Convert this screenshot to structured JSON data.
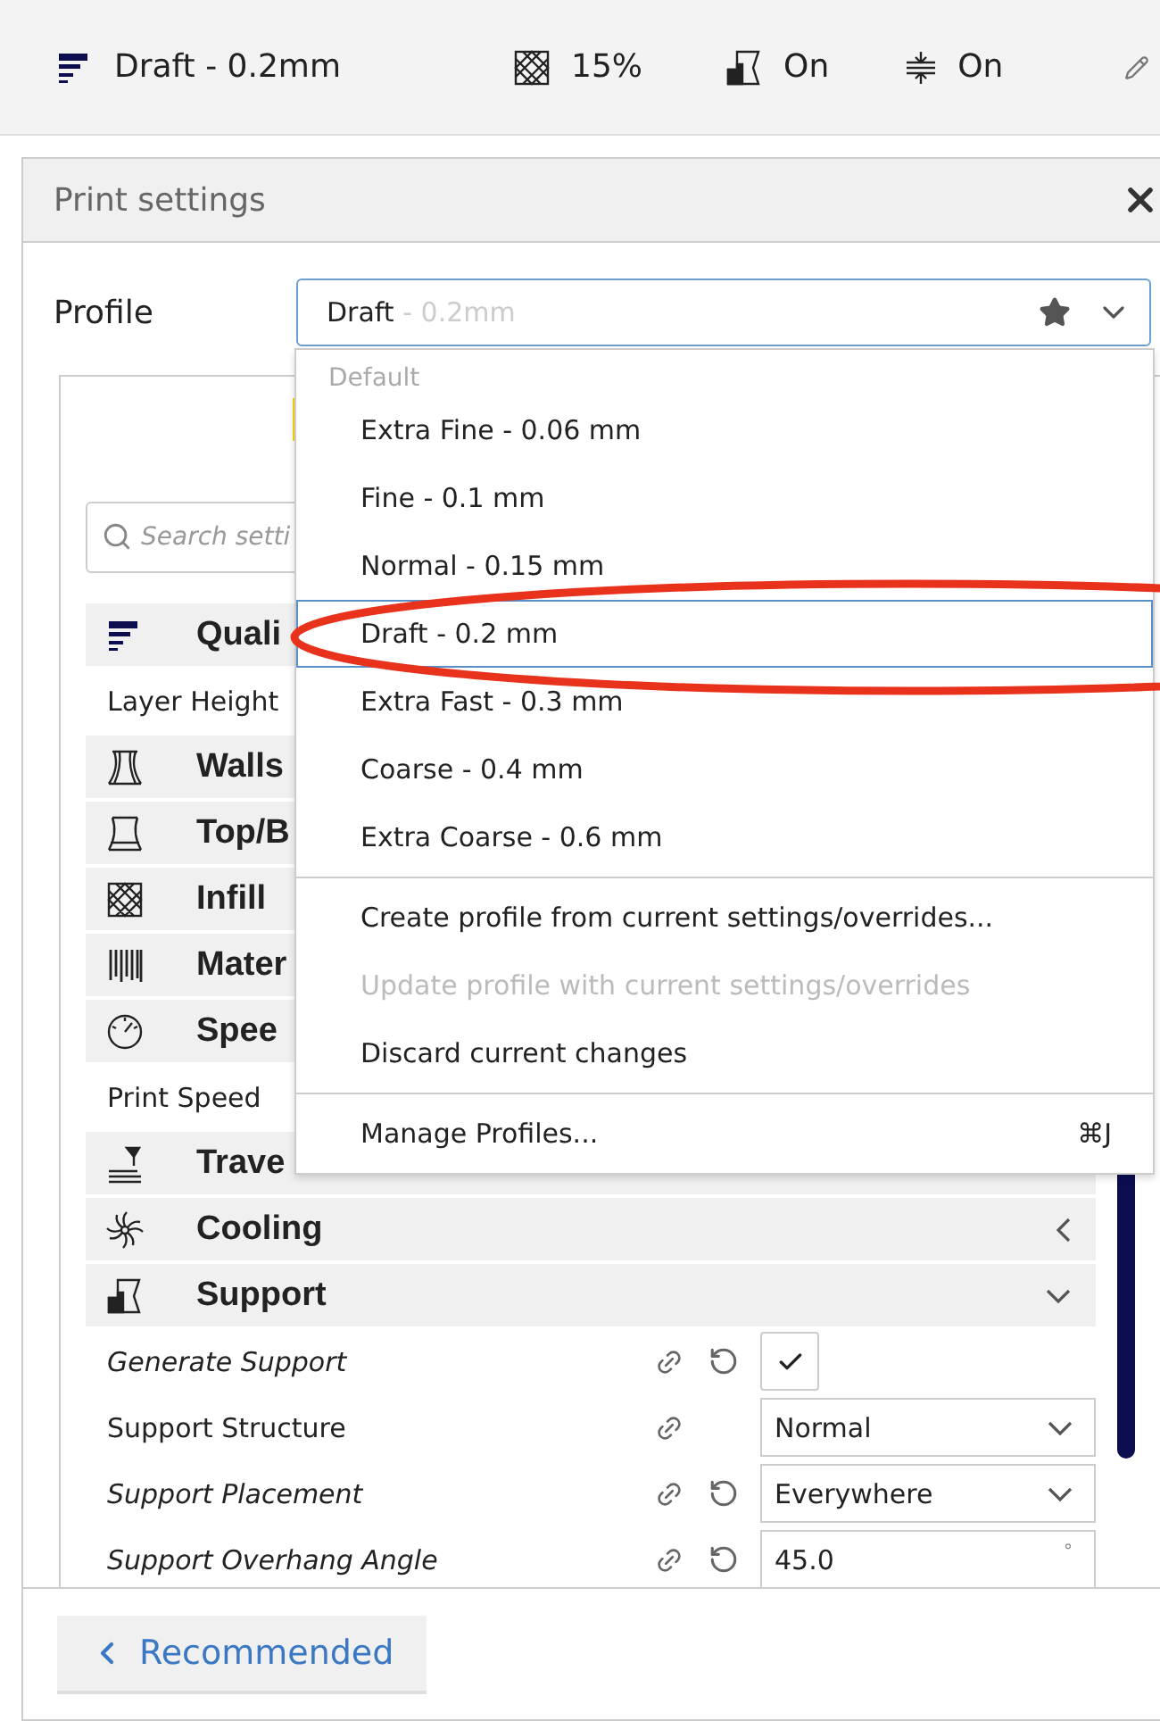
{
  "top_bar": {
    "profile": "Draft - 0.2mm",
    "infill": "15%",
    "support": "On",
    "adhesion": "On"
  },
  "panel": {
    "title": "Print settings",
    "profile_label": "Profile",
    "profile_combo": {
      "name": "Draft",
      "suffix": "- 0.2mm"
    },
    "search": {
      "placeholder": "Search setti"
    },
    "settings": [
      {
        "kind": "category",
        "label": "Quali"
      },
      {
        "kind": "setting",
        "label": "Layer Height",
        "overridden": false
      },
      {
        "kind": "category",
        "label": "Walls"
      },
      {
        "kind": "category",
        "label": "Top/B"
      },
      {
        "kind": "category",
        "label": "Infill"
      },
      {
        "kind": "category",
        "label": "Mater"
      },
      {
        "kind": "category",
        "label": "Spee"
      },
      {
        "kind": "setting",
        "label": "Print Speed",
        "overridden": false
      },
      {
        "kind": "category",
        "label": "Trave"
      },
      {
        "kind": "category",
        "label": "Cooling",
        "expanded": false
      },
      {
        "kind": "category",
        "label": "Support",
        "expanded": true
      },
      {
        "kind": "setting",
        "label": "Generate Support",
        "overridden": true,
        "linked": true,
        "control": {
          "kind": "checkbox",
          "checked": true
        }
      },
      {
        "kind": "setting",
        "label": "Support Structure",
        "overridden": false,
        "linked": true,
        "control": {
          "kind": "select",
          "value": "Normal"
        }
      },
      {
        "kind": "setting",
        "label": "Support Placement",
        "overridden": true,
        "linked": true,
        "control": {
          "kind": "select",
          "value": "Everywhere"
        }
      },
      {
        "kind": "setting",
        "label": "Support Overhang Angle",
        "overridden": true,
        "linked": true,
        "control": {
          "kind": "number",
          "value": "45.0",
          "unit": "°"
        }
      }
    ],
    "footer_button": "Recommended"
  },
  "profile_menu": {
    "group_label": "Default",
    "profiles": [
      {
        "label": "Extra Fine - 0.06 mm",
        "selected": false
      },
      {
        "label": "Fine - 0.1 mm",
        "selected": false
      },
      {
        "label": "Normal - 0.15 mm",
        "selected": false
      },
      {
        "label": "Draft - 0.2 mm",
        "selected": true
      },
      {
        "label": "Extra Fast - 0.3 mm",
        "selected": false
      },
      {
        "label": "Coarse - 0.4 mm",
        "selected": false
      },
      {
        "label": "Extra Coarse - 0.6 mm",
        "selected": false
      }
    ],
    "actions": [
      {
        "label": "Create profile from current settings/overrides...",
        "disabled": false
      },
      {
        "label": "Update profile with current settings/overrides",
        "disabled": true
      },
      {
        "label": "Discard current changes",
        "disabled": false
      }
    ],
    "manage": {
      "label": "Manage Profiles...",
      "shortcut": "⌘J"
    }
  }
}
